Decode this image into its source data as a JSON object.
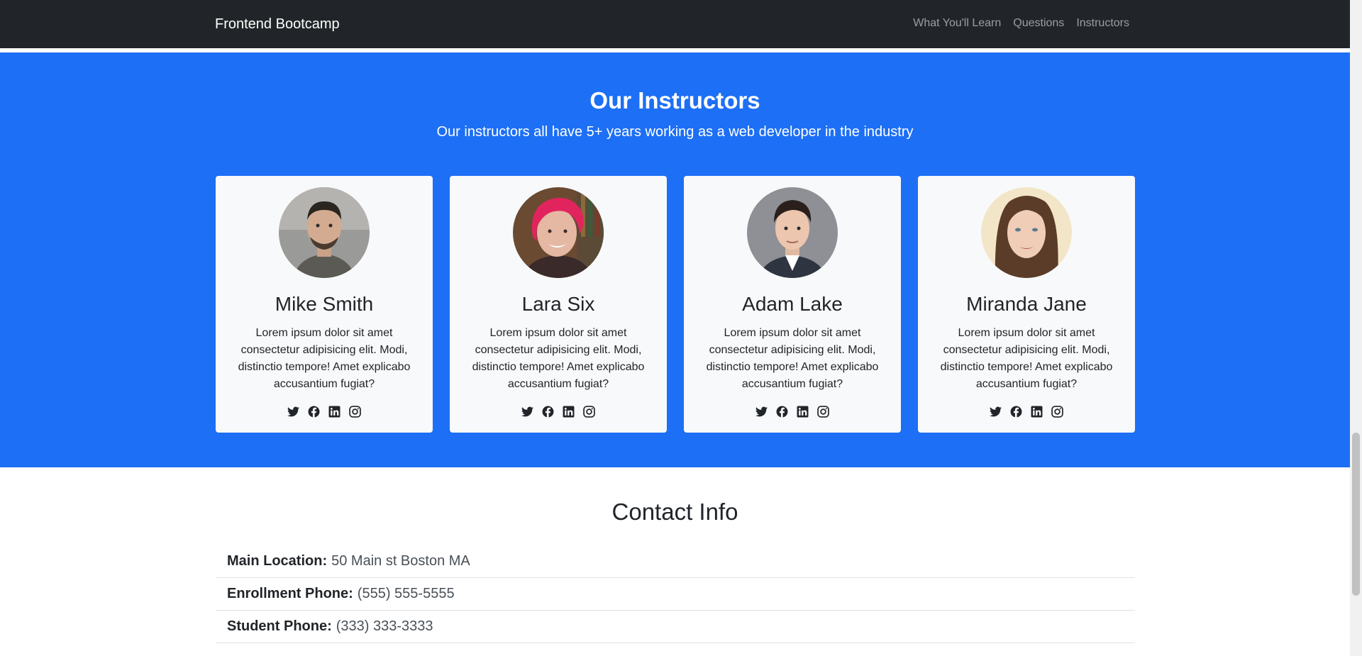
{
  "navbar": {
    "brand": "Frontend Bootcamp",
    "links": [
      "What You'll Learn",
      "Questions",
      "Instructors"
    ]
  },
  "instructors": {
    "title": "Our Instructors",
    "subtitle": "Our instructors all have 5+ years working as a web developer in the industry",
    "cards": [
      {
        "name": "Mike Smith",
        "text": "Lorem ipsum dolor sit amet consectetur adipisicing elit. Modi, distinctio tempore! Amet explicabo accusantium fugiat?"
      },
      {
        "name": "Lara Six",
        "text": "Lorem ipsum dolor sit amet consectetur adipisicing elit. Modi, distinctio tempore! Amet explicabo accusantium fugiat?"
      },
      {
        "name": "Adam Lake",
        "text": "Lorem ipsum dolor sit amet consectetur adipisicing elit. Modi, distinctio tempore! Amet explicabo accusantium fugiat?"
      },
      {
        "name": "Miranda Jane",
        "text": "Lorem ipsum dolor sit amet consectetur adipisicing elit. Modi, distinctio tempore! Amet explicabo accusantium fugiat?"
      }
    ],
    "social_icons": [
      "twitter-icon",
      "facebook-icon",
      "linkedin-icon",
      "instagram-icon"
    ]
  },
  "contact": {
    "title": "Contact Info",
    "rows": [
      {
        "label": "Main Location:",
        "value": "50 Main st Boston MA"
      },
      {
        "label": "Enrollment Phone:",
        "value": "(555) 555-5555"
      },
      {
        "label": "Student Phone:",
        "value": "(333) 333-3333"
      }
    ]
  },
  "colors": {
    "navbar": "#212529",
    "primary": "#1d6ff5",
    "card": "#f8f9fa"
  }
}
